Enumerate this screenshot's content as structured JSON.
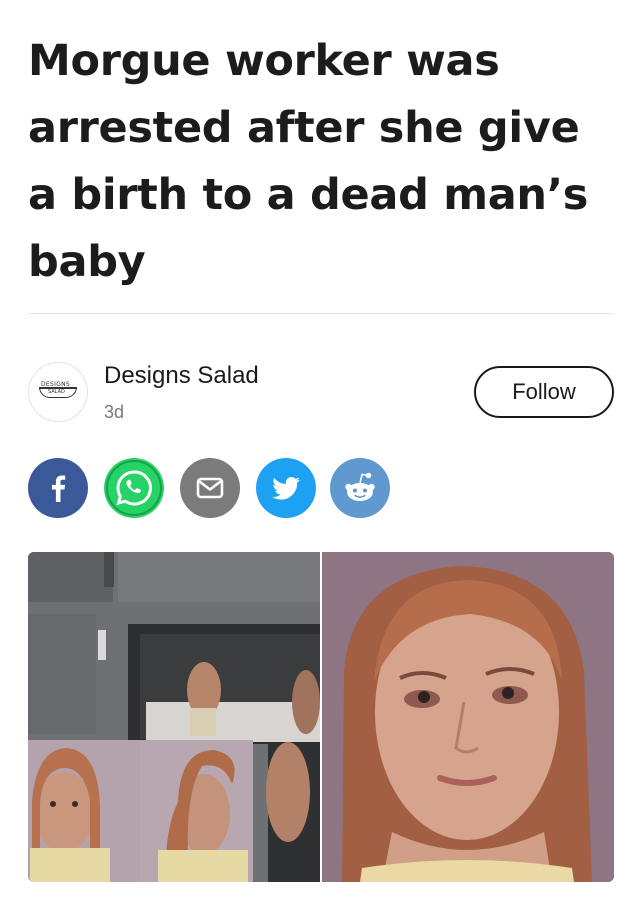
{
  "article": {
    "headline": "Morgue worker was arrested after she give a birth to a dead man’s baby"
  },
  "author": {
    "name": "Designs Salad",
    "age": "3d",
    "avatar_text_top": "DESIGNS",
    "avatar_text_bottom": "SALAD",
    "follow_label": "Follow"
  },
  "share_buttons": [
    {
      "network": "facebook",
      "icon": "facebook-icon",
      "color": "#3b5998"
    },
    {
      "network": "whatsapp",
      "icon": "whatsapp-icon",
      "color": "#25d366"
    },
    {
      "network": "email",
      "icon": "envelope-icon",
      "color": "#7b7b7b"
    },
    {
      "network": "twitter",
      "icon": "twitter-bird-icon",
      "color": "#1da1f2"
    },
    {
      "network": "reddit",
      "icon": "reddit-alien-icon",
      "color": "#5f99cf"
    }
  ],
  "images": [
    {
      "name": "morgue-collage-photo"
    },
    {
      "name": "mugshot-photo"
    }
  ]
}
